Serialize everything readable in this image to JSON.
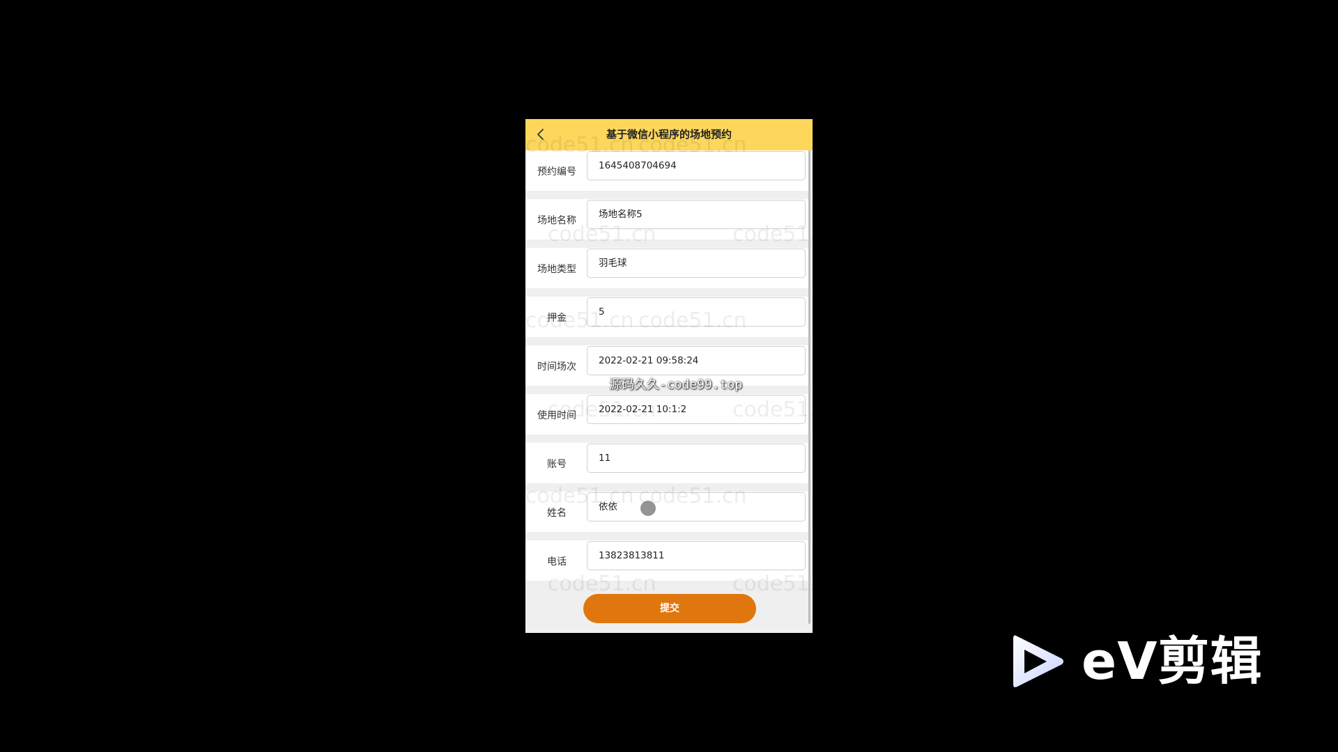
{
  "app": {
    "title": "基于微信小程序的场地预约"
  },
  "form": {
    "fields": [
      {
        "label": "预约编号",
        "value": "1645408704694"
      },
      {
        "label": "场地名称",
        "value": "场地名称5"
      },
      {
        "label": "场地类型",
        "value": "羽毛球"
      },
      {
        "label": "押金",
        "value": "5"
      },
      {
        "label": "时间场次",
        "value": "2022-02-21 09:58:24"
      },
      {
        "label": "使用时间",
        "value": "2022-02-21 10:1:2"
      },
      {
        "label": "账号",
        "value": "11"
      },
      {
        "label": "姓名",
        "value": "依依"
      },
      {
        "label": "电话",
        "value": "13823813811"
      }
    ],
    "submit_label": "提交"
  },
  "watermarks": {
    "background_text": "code51.cn",
    "overlay_text": "源码久久-code99.top"
  },
  "branding": {
    "editor_logo_text": "eV剪辑",
    "icon": "play-triangle-icon"
  },
  "colors": {
    "header_bg": "#fcd75c",
    "submit_bg": "#e0770e",
    "page_bg": "#efefef"
  }
}
